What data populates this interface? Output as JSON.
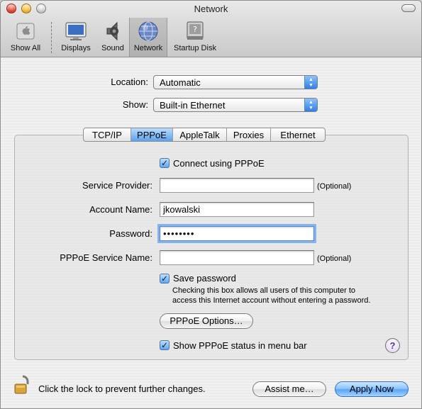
{
  "window": {
    "title": "Network"
  },
  "toolbar": {
    "items": [
      {
        "label": "Show All",
        "icon": "apple-icon"
      },
      {
        "label": "Displays",
        "icon": "display-icon"
      },
      {
        "label": "Sound",
        "icon": "speaker-icon"
      },
      {
        "label": "Network",
        "icon": "globe-icon",
        "selected": true
      },
      {
        "label": "Startup Disk",
        "icon": "disk-icon"
      }
    ]
  },
  "location": {
    "label": "Location:",
    "value": "Automatic"
  },
  "show": {
    "label": "Show:",
    "value": "Built-in Ethernet"
  },
  "tabs": {
    "items": [
      "TCP/IP",
      "PPPoE",
      "AppleTalk",
      "Proxies",
      "Ethernet"
    ],
    "active": "PPPoE"
  },
  "pppoe": {
    "connect_label": "Connect using PPPoE",
    "connect_checked": true,
    "service_provider": {
      "label": "Service Provider:",
      "value": "",
      "note": "(Optional)"
    },
    "account_name": {
      "label": "Account Name:",
      "value": "jkowalski"
    },
    "password": {
      "label": "Password:",
      "value": "••••••••"
    },
    "service_name": {
      "label": "PPPoE Service Name:",
      "value": "",
      "note": "(Optional)"
    },
    "save_password": {
      "label": "Save password",
      "checked": true,
      "note_line1": "Checking this box allows all users of this computer to",
      "note_line2": "access this Internet account without entering a password."
    },
    "options_button": "PPPoE Options…",
    "status_label": "Show PPPoE status in menu bar",
    "status_checked": true,
    "help": "?"
  },
  "footer": {
    "lock_text": "Click the lock to prevent further changes.",
    "assist_button": "Assist me…",
    "apply_button": "Apply Now"
  },
  "colors": {
    "accent": "#5ba4f6",
    "checkbox": "#5ea5ef"
  }
}
